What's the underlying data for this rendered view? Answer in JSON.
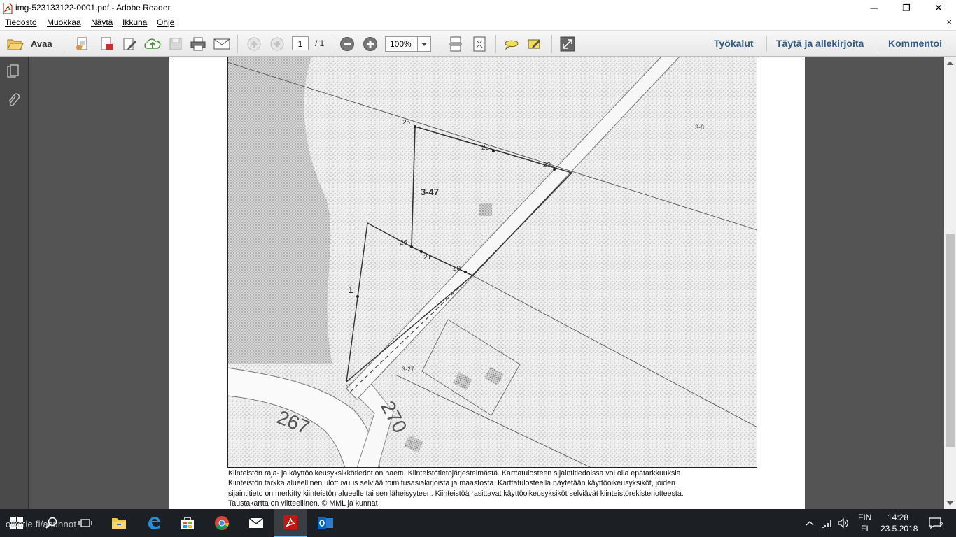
{
  "window": {
    "title": "img-523133122-0001.pdf - Adobe Reader",
    "controls": {
      "minimize": "—",
      "maximize": "❐",
      "close": "✕"
    }
  },
  "menubar": {
    "items": [
      "Tiedosto",
      "Muokkaa",
      "Näytä",
      "Ikkuna",
      "Ohje"
    ],
    "close_doc": "×"
  },
  "toolbar": {
    "open_label": "Avaa",
    "page_current": "1",
    "page_total": "/ 1",
    "zoom": "100%",
    "tools_label": "Työkalut",
    "fill_sign_label": "Täytä ja allekirjoita",
    "comment_label": "Kommentoi"
  },
  "map": {
    "labels": {
      "parcel_main": "3-47",
      "parcel_ne": "3-8",
      "parcel_s": "3-27",
      "road_a": "270",
      "road_b": "267",
      "point_1": "1",
      "point_25": "25",
      "point_22": "22",
      "point_23": "23",
      "point_26": "26",
      "point_21": "21",
      "point_20": "20"
    }
  },
  "caption": {
    "lines": [
      "Kiinteistön raja- ja käyttöoikeusyksikkötiedot on haettu Kiinteistötietojärjestelmästä. Karttatulosteen sijaintitiedoissa voi olla epätarkkuuksia.",
      "Kiinteistön tarkka alueellinen ulottuvuus selviää toimitusasiakirjoista ja maastosta. Karttatulosteella näytetään käyttöoikeusyksiköt, joiden",
      "sijaintitieto on merkitty kiinteistön alueelle tai sen läheisyyteen. Kiinteistöä rasittavat käyttöoikeusyksiköt selviävät kiinteistörekisteriotteesta.",
      "Taustakartta on viitteellinen. © MML ja kunnat"
    ]
  },
  "taskbar": {
    "watermark": "oikotie.fi/asunnot",
    "language_top": "FIN",
    "language_bottom": "FI",
    "time": "14:28",
    "date": "23.5.2018",
    "notification_count": "2"
  },
  "colors": {
    "link_blue": "#2f5a8a",
    "doc_background": "#545454",
    "taskbar": "#1c1f24"
  }
}
